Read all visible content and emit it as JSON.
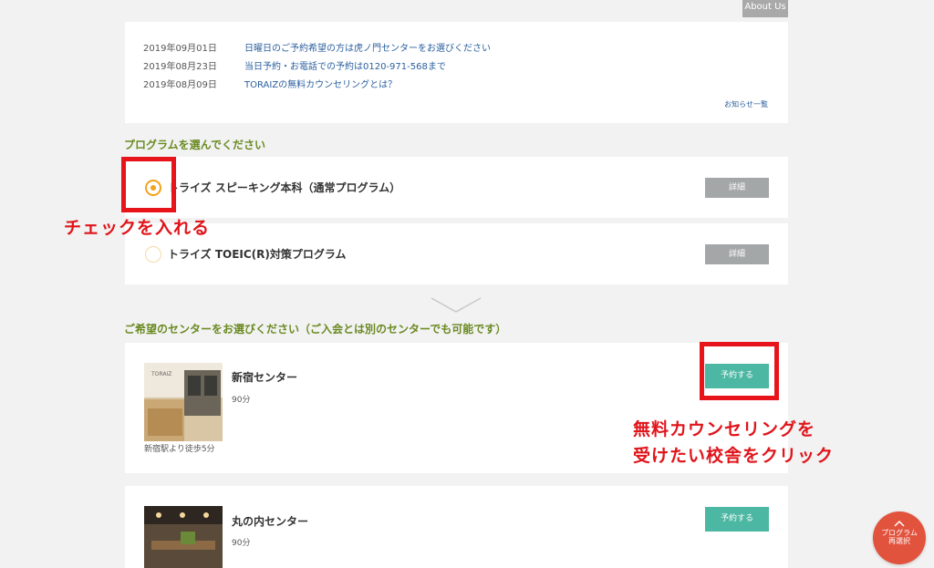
{
  "about_tab": "About Us",
  "news": {
    "items": [
      {
        "date": "2019年09月01日",
        "title": "日曜日のご予約希望の方は虎ノ門センターをお選びください"
      },
      {
        "date": "2019年08月23日",
        "title": "当日予約・お電話での予約は0120-971-568まで"
      },
      {
        "date": "2019年08月09日",
        "title": "TORAIZの無料カウンセリングとは？"
      }
    ],
    "more_link": "お知らせ一覧"
  },
  "program_section": {
    "title": "プログラムを選んでください",
    "programs": [
      {
        "label": "トライズ スピーキング本科（通常プログラム）",
        "selected": true,
        "detail": "詳細"
      },
      {
        "label": "トライズ TOEIC(R)対策プログラム",
        "selected": false,
        "detail": "詳細"
      }
    ]
  },
  "center_section": {
    "title": "ご希望のセンターをお選びください（ご入会とは別のセンターでも可能です）",
    "centers": [
      {
        "name": "新宿センター",
        "duration": "90分",
        "note": "新宿駅より徒歩5分",
        "button": "予約する"
      },
      {
        "name": "丸の内センター",
        "duration": "90分",
        "note": "",
        "button": "予約する"
      }
    ]
  },
  "annotations": {
    "check": "チェックを入れる",
    "click_line1": "無料カウンセリングを",
    "click_line2": "受けたい校舎をクリック"
  },
  "fab": {
    "line1": "プログラム",
    "line2": "再選択"
  },
  "colors": {
    "accent_green": "#6a8a22",
    "book_button": "#4cb7a2",
    "radio_orange": "#f3a21a",
    "annotation_red": "#e8141b"
  }
}
